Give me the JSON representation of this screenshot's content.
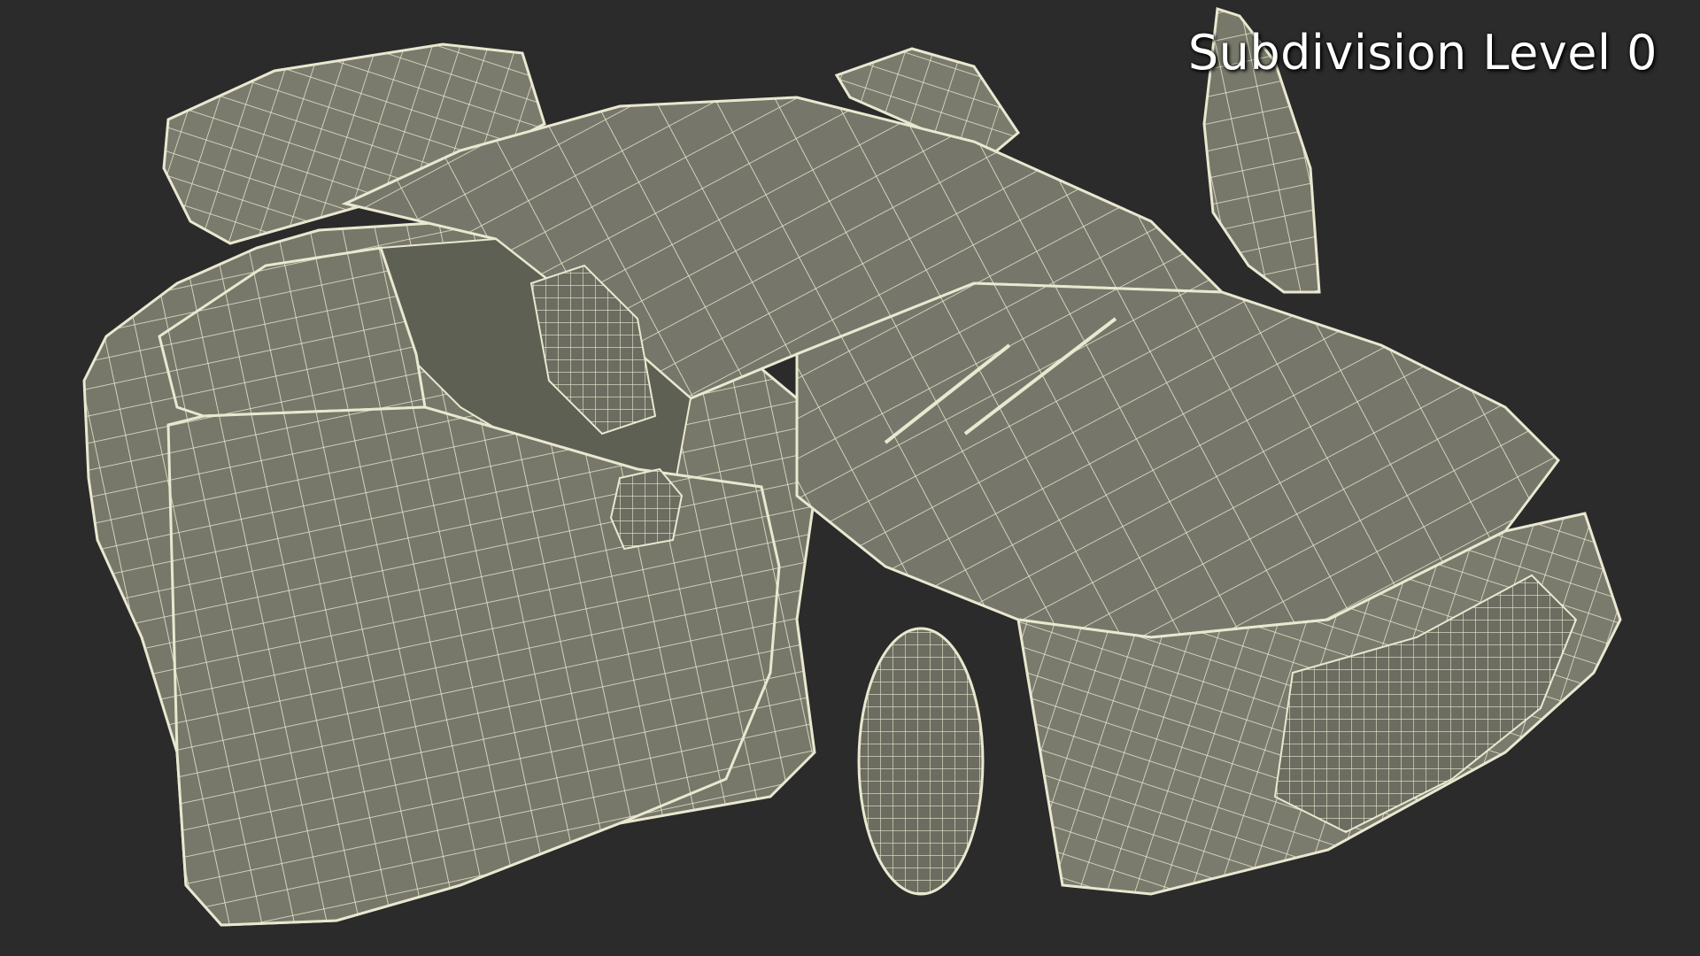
{
  "viewport": {
    "subdivision_label": "Subdivision Level 0"
  },
  "colors": {
    "background": "#2b2b2b",
    "surface": "#77786a",
    "surface_dark": "#5f6054",
    "wire": "#e9e8d0",
    "label": "#ffffff"
  },
  "model": {
    "icon": "wireframe-car-mesh"
  }
}
